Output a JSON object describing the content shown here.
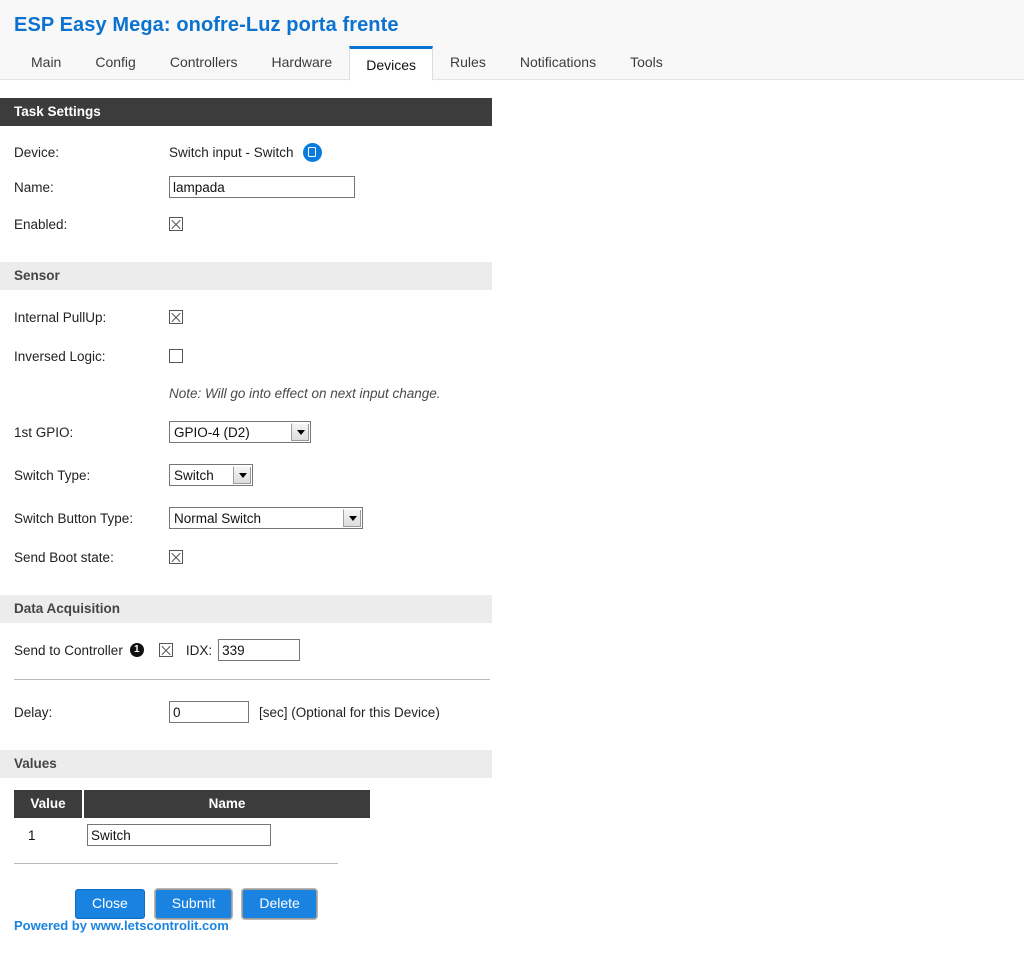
{
  "header": {
    "title": "ESP Easy Mega: onofre-Luz porta frente",
    "tabs": [
      {
        "label": "Main",
        "active": false
      },
      {
        "label": "Config",
        "active": false
      },
      {
        "label": "Controllers",
        "active": false
      },
      {
        "label": "Hardware",
        "active": false
      },
      {
        "label": "Devices",
        "active": true
      },
      {
        "label": "Rules",
        "active": false
      },
      {
        "label": "Notifications",
        "active": false
      },
      {
        "label": "Tools",
        "active": false
      }
    ]
  },
  "task_settings": {
    "section_title": "Task Settings",
    "device_label": "Device:",
    "device_value": "Switch input - Switch",
    "device_info_icon": "book-icon",
    "name_label": "Name:",
    "name_value": "lampada",
    "enabled_label": "Enabled:",
    "enabled_checked": true
  },
  "sensor": {
    "section_title": "Sensor",
    "internal_pullup_label": "Internal PullUp:",
    "internal_pullup_checked": true,
    "inversed_logic_label": "Inversed Logic:",
    "inversed_logic_checked": false,
    "note": "Note: Will go into effect on next input change.",
    "gpio_label": "1st GPIO:",
    "gpio_value": "GPIO-4 (D2)",
    "switch_type_label": "Switch Type:",
    "switch_type_value": "Switch",
    "switch_button_type_label": "Switch Button Type:",
    "switch_button_type_value": "Normal Switch",
    "send_boot_state_label": "Send Boot state:",
    "send_boot_state_checked": true
  },
  "data_acquisition": {
    "section_title": "Data Acquisition",
    "send_to_controller_label": "Send to Controller",
    "controller_number": "1",
    "send_to_controller_checked": true,
    "idx_label": "IDX:",
    "idx_value": "339",
    "delay_label": "Delay:",
    "delay_value": "0",
    "delay_suffix": "[sec] (Optional for this Device)"
  },
  "values": {
    "section_title": "Values",
    "columns": [
      "Value",
      "Name"
    ],
    "rows": [
      {
        "value": "1",
        "name": "Switch"
      }
    ]
  },
  "actions": {
    "close": "Close",
    "submit": "Submit",
    "delete": "Delete"
  },
  "footer": {
    "text": "Powered by www.letscontrolit.com"
  },
  "colors": {
    "accent_blue": "#1a83e2",
    "title_blue": "#0b72d0",
    "section_dark": "#3c3c3c",
    "subsection_gray": "#ececec"
  }
}
